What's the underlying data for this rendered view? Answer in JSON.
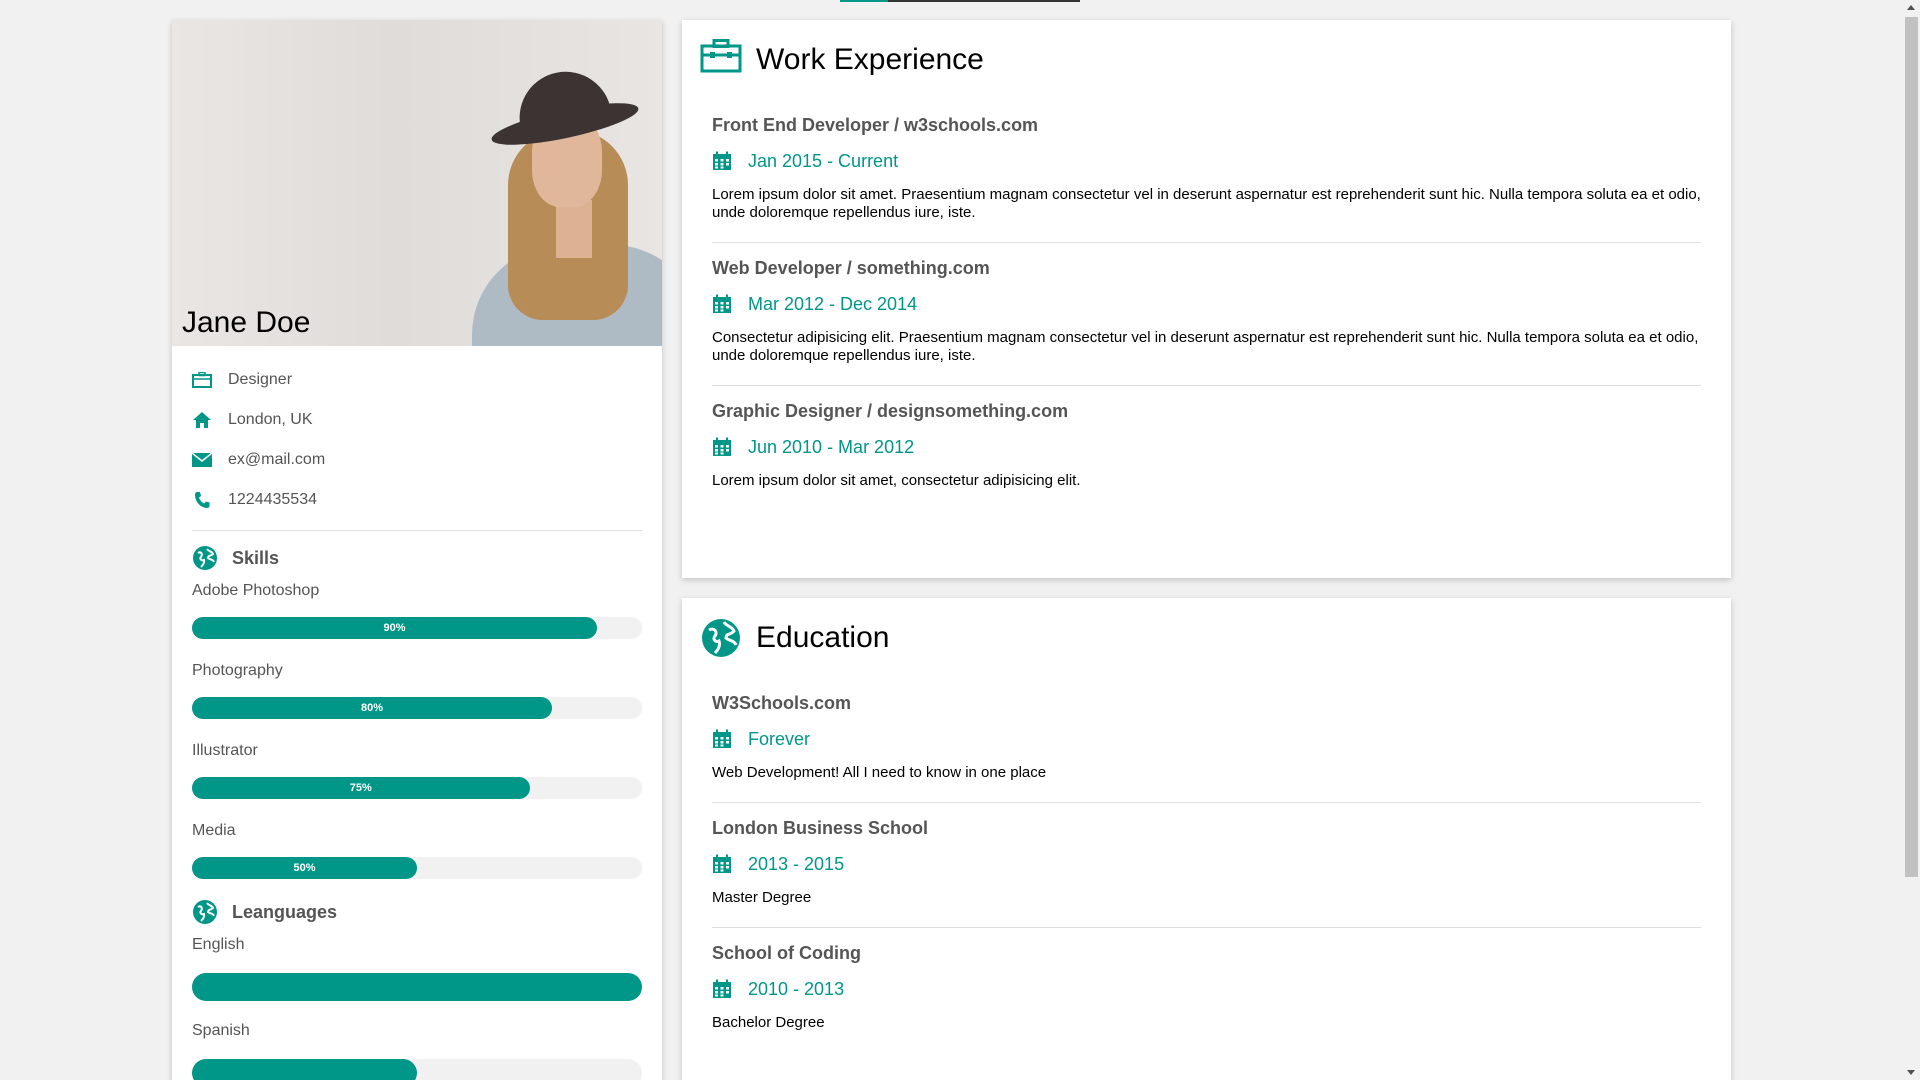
{
  "colors": {
    "accent": "#009688",
    "background": "#f1f1f1"
  },
  "profile": {
    "name": "Jane Doe",
    "title": "Designer",
    "location": "London, UK",
    "email": "ex@mail.com",
    "phone": "1224435534"
  },
  "skills": {
    "heading": "Skills",
    "items": [
      {
        "label": "Adobe Photoshop",
        "percent": 90,
        "text": "90%"
      },
      {
        "label": "Photography",
        "percent": 80,
        "text": "80%"
      },
      {
        "label": "Illustrator",
        "percent": 75,
        "text": "75%"
      },
      {
        "label": "Media",
        "percent": 50,
        "text": "50%"
      }
    ]
  },
  "languages": {
    "heading": "Leanguages",
    "items": [
      {
        "label": "English",
        "percent": 100
      },
      {
        "label": "Spanish",
        "percent": 50
      }
    ]
  },
  "work": {
    "heading": "Work Experience",
    "entries": [
      {
        "title": "Front End Developer / w3schools.com",
        "date": "Jan 2015 - Current",
        "description": "Lorem ipsum dolor sit amet. Praesentium magnam consectetur vel in deserunt aspernatur est reprehenderit sunt hic. Nulla tempora soluta ea et odio, unde doloremque repellendus iure, iste."
      },
      {
        "title": "Web Developer / something.com",
        "date": "Mar 2012 - Dec 2014",
        "description": "Consectetur adipisicing elit. Praesentium magnam consectetur vel in deserunt aspernatur est reprehenderit sunt hic. Nulla tempora soluta ea et odio, unde doloremque repellendus iure, iste."
      },
      {
        "title": "Graphic Designer / designsomething.com",
        "date": "Jun 2010 - Mar 2012",
        "description": "Lorem ipsum dolor sit amet, consectetur adipisicing elit."
      }
    ]
  },
  "education": {
    "heading": "Education",
    "entries": [
      {
        "title": "W3Schools.com",
        "date": "Forever",
        "description": "Web Development! All I need to know in one place"
      },
      {
        "title": "London Business School",
        "date": "2013 - 2015",
        "description": "Master Degree"
      },
      {
        "title": "School of Coding",
        "date": "2010 - 2013",
        "description": "Bachelor Degree"
      }
    ]
  },
  "icons": {
    "title": "briefcase-icon",
    "location": "home-icon",
    "email": "envelope-icon",
    "phone": "phone-icon",
    "section": "globe-icon",
    "date": "calendar-icon"
  }
}
